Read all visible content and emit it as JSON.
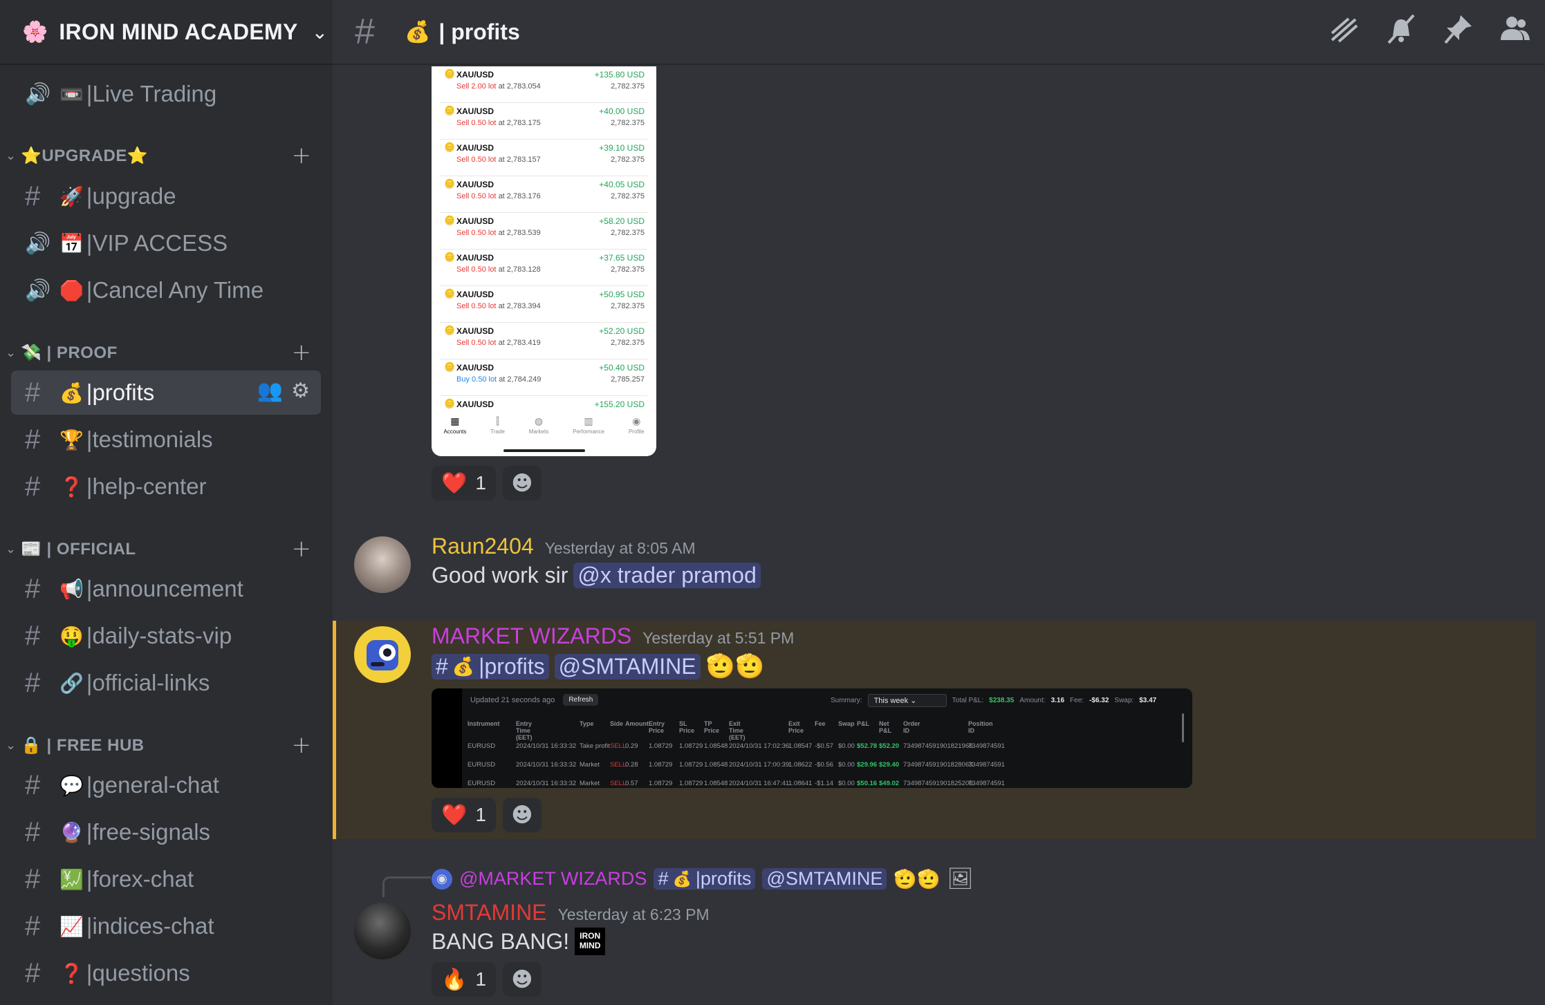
{
  "server": {
    "name": "IRON MIND ACADEMY",
    "icon": "🌸"
  },
  "sidebar": {
    "channels_top": [
      {
        "emoji": "📼",
        "name": "|Live Trading",
        "kind": "voice"
      }
    ],
    "categories": [
      {
        "name": "⭐UPGRADE⭐",
        "channels": [
          {
            "emoji": "🚀",
            "name": "|upgrade",
            "kind": "text"
          },
          {
            "emoji": "📅",
            "name": "|VIP ACCESS",
            "kind": "voice"
          },
          {
            "emoji": "🛑",
            "name": "|Cancel Any Time",
            "kind": "voice"
          }
        ]
      },
      {
        "name": "💸 | PROOF",
        "channels": [
          {
            "emoji": "💰",
            "name": "|profits",
            "kind": "text",
            "active": true
          },
          {
            "emoji": "🏆",
            "name": "|testimonials",
            "kind": "text"
          },
          {
            "emoji": "❓",
            "name": "|help-center",
            "kind": "text"
          }
        ]
      },
      {
        "name": "📰 | OFFICIAL",
        "channels": [
          {
            "emoji": "📢",
            "name": "|announcement",
            "kind": "text"
          },
          {
            "emoji": "🤑",
            "name": "|daily-stats-vip",
            "kind": "text"
          },
          {
            "emoji": "🔗",
            "name": "|official-links",
            "kind": "text"
          }
        ]
      },
      {
        "name": "🔒 | FREE HUB",
        "channels": [
          {
            "emoji": "💬",
            "name": "|general-chat",
            "kind": "text"
          },
          {
            "emoji": "🔮",
            "name": "|free-signals",
            "kind": "text"
          },
          {
            "emoji": "💹",
            "name": "|forex-chat",
            "kind": "text"
          },
          {
            "emoji": "📈",
            "name": "|indices-chat",
            "kind": "text"
          },
          {
            "emoji": "❓",
            "name": "|questions",
            "kind": "text"
          }
        ]
      }
    ]
  },
  "header": {
    "channel_emoji": "💰",
    "channel_name": "| profits"
  },
  "phone_screenshot": {
    "trades": [
      {
        "symbol": "XAU/USD",
        "side": "Sell",
        "lot": "2.00 lot",
        "at": "at 2,783.054",
        "pl": "+135.80 USD",
        "price": "2,782.375"
      },
      {
        "symbol": "XAU/USD",
        "side": "Sell",
        "lot": "0.50 lot",
        "at": "at 2,783.175",
        "pl": "+40.00 USD",
        "price": "2,782.375"
      },
      {
        "symbol": "XAU/USD",
        "side": "Sell",
        "lot": "0.50 lot",
        "at": "at 2,783.157",
        "pl": "+39.10 USD",
        "price": "2,782.375"
      },
      {
        "symbol": "XAU/USD",
        "side": "Sell",
        "lot": "0.50 lot",
        "at": "at 2,783.176",
        "pl": "+40.05 USD",
        "price": "2,782.375"
      },
      {
        "symbol": "XAU/USD",
        "side": "Sell",
        "lot": "0.50 lot",
        "at": "at 2,783.539",
        "pl": "+58.20 USD",
        "price": "2,782.375"
      },
      {
        "symbol": "XAU/USD",
        "side": "Sell",
        "lot": "0.50 lot",
        "at": "at 2,783.128",
        "pl": "+37.65 USD",
        "price": "2,782.375"
      },
      {
        "symbol": "XAU/USD",
        "side": "Sell",
        "lot": "0.50 lot",
        "at": "at 2,783.394",
        "pl": "+50.95 USD",
        "price": "2,782.375"
      },
      {
        "symbol": "XAU/USD",
        "side": "Sell",
        "lot": "0.50 lot",
        "at": "at 2,783.419",
        "pl": "+52.20 USD",
        "price": "2,782.375"
      },
      {
        "symbol": "XAU/USD",
        "side": "Buy",
        "lot": "0.50 lot",
        "at": "at 2,784.249",
        "pl": "+50.40 USD",
        "price": "2,785.257"
      },
      {
        "symbol": "XAU/USD",
        "side": "",
        "lot": "",
        "at": "",
        "pl": "+155.20 USD",
        "price": ""
      }
    ],
    "nav": [
      "Accounts",
      "Trade",
      "Markets",
      "Performance",
      "Profile"
    ]
  },
  "messages": [
    {
      "author": "Raun2404",
      "author_color": "#f0c33c",
      "timestamp": "Yesterday at 8:05 AM",
      "text": "Good work sir",
      "mention": "@x trader pramod"
    },
    {
      "author": "MARKET WIZARDS",
      "author_color": "#c93fe0",
      "timestamp": "Yesterday at 5:51 PM",
      "channel_mention_emoji": "💰",
      "channel_mention": "|profits",
      "mention": "@SMTAMINE",
      "emojis": "🫡🫡"
    },
    {
      "author": "SMTAMINE",
      "author_color": "#e53935",
      "timestamp": "Yesterday at 6:23 PM",
      "text": "BANG BANG!",
      "badge": "IRON MIND"
    }
  ],
  "reply_preview": {
    "name": "@MARKET WIZARDS",
    "channel_emoji": "💰",
    "channel": "|profits",
    "mention": "@SMTAMINE",
    "emojis": "🫡🫡"
  },
  "reactions": {
    "first": {
      "emoji": "❤️",
      "count": "1"
    },
    "second": {
      "emoji": "❤️",
      "count": "1"
    },
    "third": {
      "emoji": "🔥",
      "count": "1"
    }
  },
  "dark_screenshot": {
    "updated": "Updated 21 seconds ago",
    "refresh": "Refresh",
    "summary_label": "Summary:",
    "summary_value": "This week",
    "total_pl_label": "Total P&L:",
    "total_pl": "$238.35",
    "amount_label": "Amount:",
    "amount": "3.16",
    "fee_label": "Fee:",
    "fee": "-$6.32",
    "swap_label": "Swap:",
    "swap": "$3.47",
    "columns": [
      "Instrument",
      "Entry Time (EET)",
      "Type",
      "Side",
      "Amount",
      "Entry Price",
      "SL Price",
      "TP Price",
      "Exit Time (EET)",
      "Exit Price",
      "Fee",
      "Swap",
      "P&L",
      "Net P&L",
      "Order ID",
      "Position ID"
    ],
    "rows": [
      [
        "EURUSD",
        "2024/10/31 16:33:32",
        "Take profit",
        "SELL",
        "0.29",
        "1.08729",
        "1.08729",
        "1.08548",
        "2024/10/31 17:02:36",
        "1.08547",
        "-$0.57",
        "$0.00",
        "$52.78",
        "$52.20",
        "7349874591901821966",
        "7349874591"
      ],
      [
        "EURUSD",
        "2024/10/31 16:33:32",
        "Market",
        "SELL",
        "0.28",
        "1.08729",
        "1.08729",
        "1.08548",
        "2024/10/31 17:00:39",
        "1.08622",
        "-$0.56",
        "$0.00",
        "$29.96",
        "$29.40",
        "7349874591901828063",
        "7349874591"
      ],
      [
        "EURUSD",
        "2024/10/31 16:33:32",
        "Market",
        "SELL",
        "0.57",
        "1.08729",
        "1.08729",
        "1.08548",
        "2024/10/31 16:47:41",
        "1.08641",
        "-$1.14",
        "$0.00",
        "$50.16",
        "$49.02",
        "7349874591901825206",
        "7349874591"
      ]
    ]
  }
}
